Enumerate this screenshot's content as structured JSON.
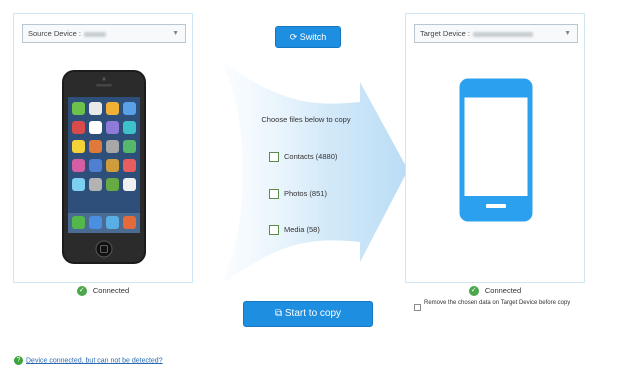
{
  "source": {
    "label": "Source Device :",
    "status": "Connected"
  },
  "target": {
    "label": "Target Device :",
    "status": "Connected"
  },
  "switch_label": "Switch",
  "choose_title": "Choose files below to copy",
  "files": [
    {
      "label": "Contacts (4880)",
      "checked": false
    },
    {
      "label": "Photos (851)",
      "checked": false
    },
    {
      "label": "Media (58)",
      "checked": false
    }
  ],
  "start_label": "Start to copy",
  "remove_option": "Remove the chosen data on Target Device before copy",
  "help_link": "Device connected, but can not be detected?",
  "icons": {
    "switch": "refresh-icon",
    "start": "copy-icon",
    "status": "check-circle-icon",
    "help": "question-icon"
  },
  "colors": {
    "accent": "#1d8ee0",
    "connected": "#4aa84a",
    "panel_border": "#cfe6f5"
  }
}
